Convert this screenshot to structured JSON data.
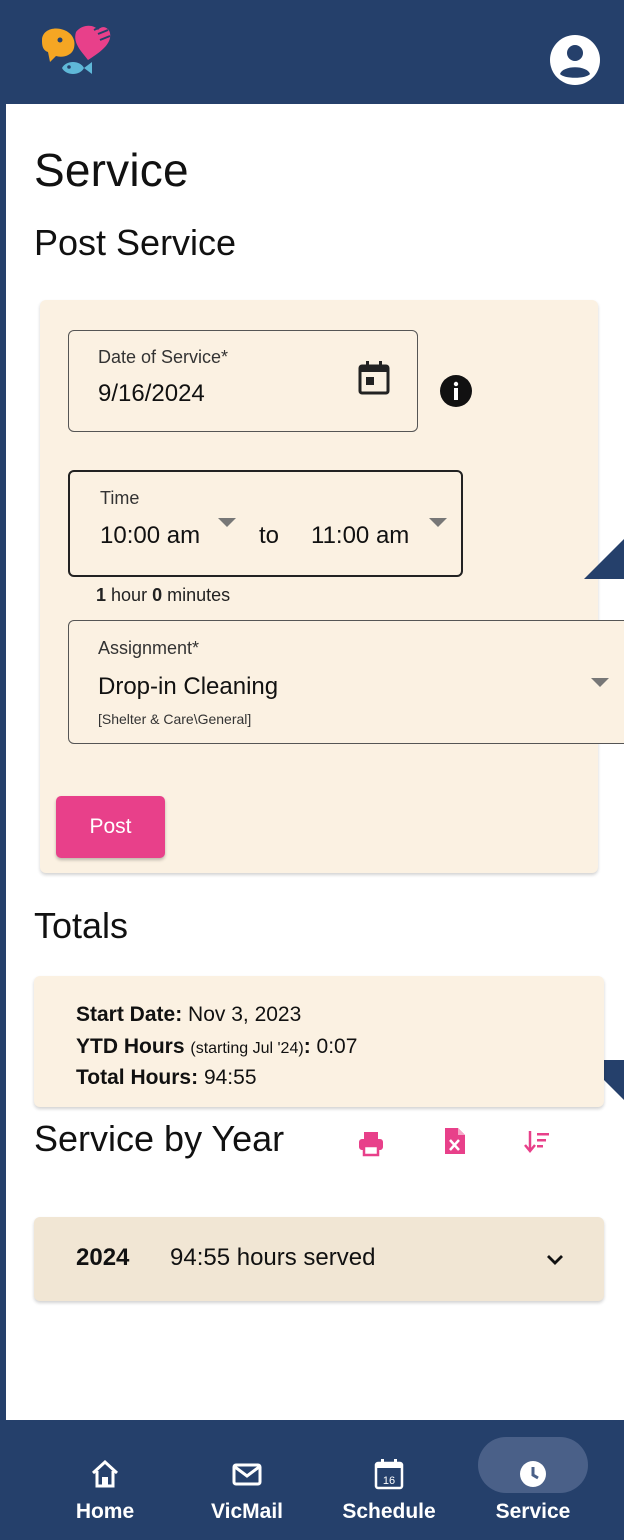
{
  "colors": {
    "header": "#25406b",
    "accent": "#e8408a",
    "card": "#fbf1e2"
  },
  "page": {
    "title": "Service"
  },
  "post_service": {
    "heading": "Post Service",
    "date_label": "Date of Service*",
    "date_value": "9/16/2024",
    "time_label": "Time",
    "time_from": "10:00 am",
    "time_to_word": "to",
    "time_to": "11:00 am",
    "duration_hours": "1",
    "duration_hours_unit": "hour",
    "duration_minutes": "0",
    "duration_minutes_unit": "minutes",
    "assignment_label": "Assignment*",
    "assignment_value": "Drop-in Cleaning",
    "assignment_sub": "[Shelter & Care\\General]",
    "post_button": "Post"
  },
  "totals": {
    "heading": "Totals",
    "start_label": "Start Date:",
    "start_value": "Nov 3, 2023",
    "ytd_label": "YTD Hours",
    "ytd_note": "(starting Jul '24)",
    "ytd_colon": ":",
    "ytd_value": "0:07",
    "total_label": "Total Hours:",
    "total_value": "94:55"
  },
  "service_by_year": {
    "heading": "Service by Year",
    "icons": [
      "print-icon",
      "excel-file-icon",
      "sort-icon"
    ],
    "rows": [
      {
        "year": "2024",
        "text": "94:55 hours served"
      }
    ]
  },
  "nav": {
    "items": [
      {
        "label": "Home",
        "icon": "home-icon"
      },
      {
        "label": "VicMail",
        "icon": "mail-icon"
      },
      {
        "label": "Schedule",
        "icon": "calendar-icon",
        "icon_text": "16"
      },
      {
        "label": "Service",
        "icon": "clock-icon",
        "active": true
      }
    ]
  }
}
